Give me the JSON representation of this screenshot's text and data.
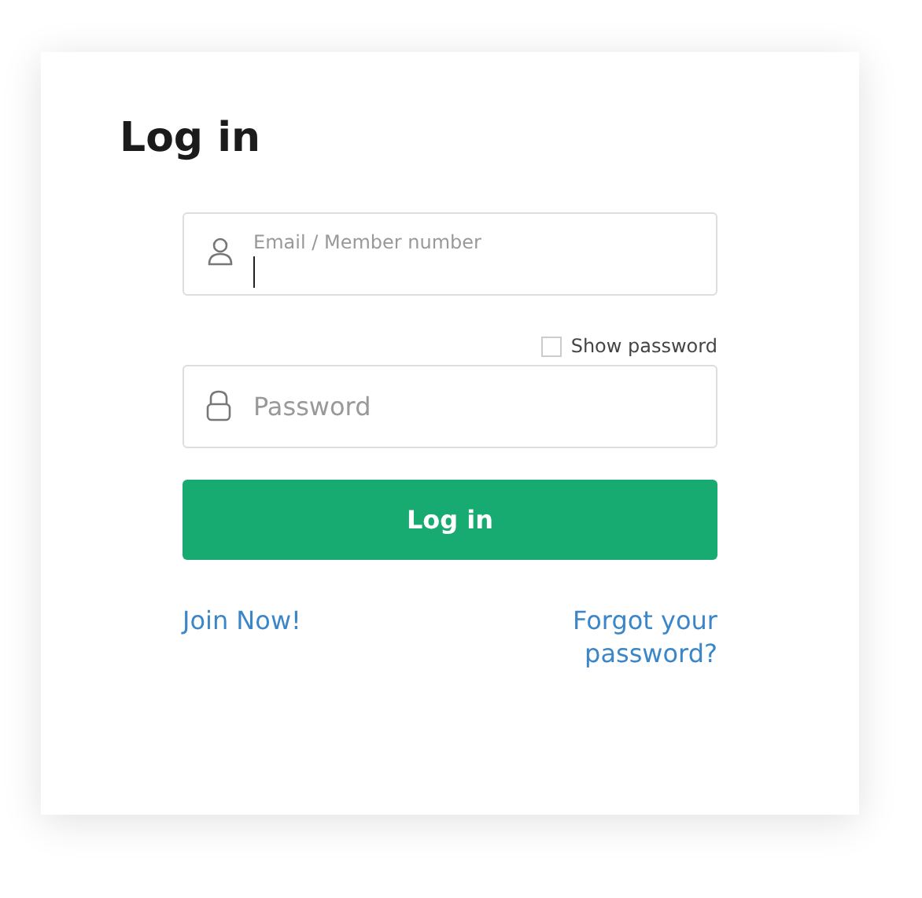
{
  "title": "Log in",
  "email_field": {
    "label": "Email / Member number",
    "focused": true
  },
  "show_password": {
    "label": "Show password",
    "checked": false
  },
  "password_field": {
    "placeholder": "Password"
  },
  "submit_button": "Log in",
  "links": {
    "join": "Join Now!",
    "forgot": "Forgot your password?"
  }
}
